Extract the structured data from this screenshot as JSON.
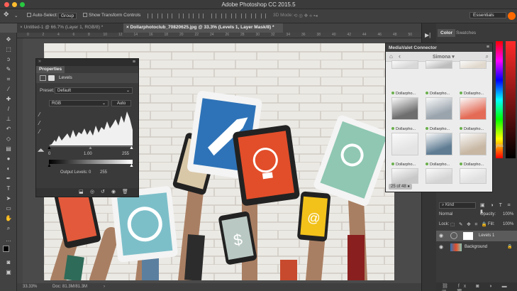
{
  "app": {
    "title": "Adobe Photoshop CC 2015.5"
  },
  "options_bar": {
    "auto_select_label": "Auto-Select:",
    "auto_select_value": "Group",
    "transform_controls_label": "Show Transform Controls",
    "mode_3d_label": "3D Mode:",
    "workspace": "Essentials"
  },
  "tabs": [
    {
      "label": "Untitled-1 @ 66.7% (Layer 1, RGB/8) *"
    },
    {
      "label": "Dollarphotoclub_70820625.jpg @ 33.3% (Levels 1, Layer Mask/8) *"
    }
  ],
  "ruler_labels": [
    "0",
    "2",
    "4",
    "6",
    "8",
    "10",
    "12",
    "14",
    "16",
    "18",
    "20",
    "22",
    "24",
    "26",
    "28",
    "30",
    "32",
    "34",
    "36",
    "38",
    "40",
    "42",
    "44",
    "46",
    "48",
    "50"
  ],
  "properties": {
    "tab": "Properties",
    "adjustment": "Levels",
    "preset_label": "Preset:",
    "preset_value": "Default",
    "channel": "RGB",
    "auto_label": "Auto",
    "input_black": "0",
    "input_gamma": "1.00",
    "input_white": "255",
    "output_label": "Output Levels:",
    "output_black": "0",
    "output_white": "255"
  },
  "mediavalet": {
    "title": "MediaValet Connector",
    "user": "Simona",
    "thumb_label": "Dollarpho...",
    "page_indicator": "25 of 48",
    "colors": {
      "dot": "#6ab04c"
    }
  },
  "color_panel": {
    "tabs": [
      "Color",
      "Swatches"
    ]
  },
  "layers": {
    "filter_kind": "Kind",
    "blend_mode": "Normal",
    "opacity_label": "Opacity:",
    "opacity_value": "100%",
    "lock_label": "Lock:",
    "fill_label": "Fill:",
    "fill_value": "100%",
    "items": [
      {
        "name": "Levels 1"
      },
      {
        "name": "Background"
      }
    ]
  },
  "status": {
    "zoom": "33.33%",
    "doc": "Doc: 81.3M/81.3M"
  }
}
